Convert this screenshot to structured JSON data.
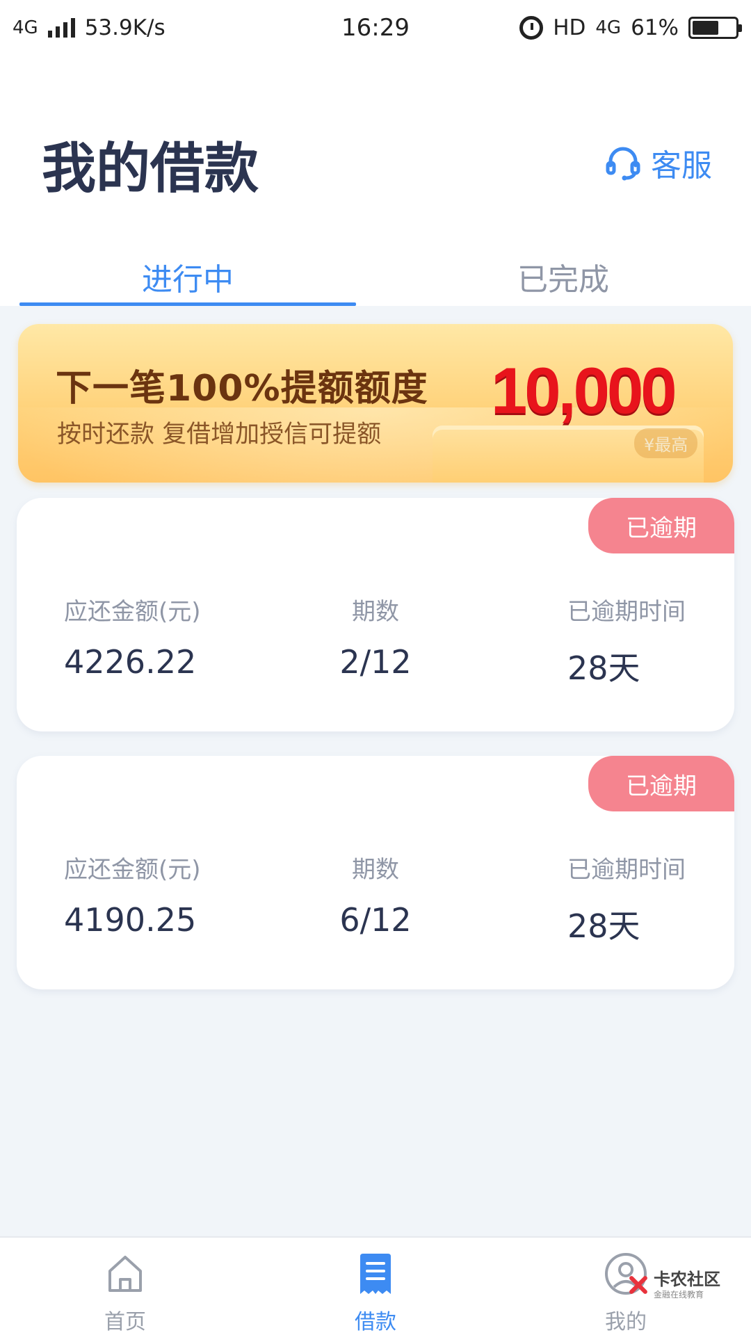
{
  "status_bar": {
    "network": "4G",
    "speed": "53.9K/s",
    "time": "16:29",
    "hd": "HD",
    "net_right": "4G",
    "battery": "61%",
    "battery_level": 0.61
  },
  "header": {
    "title": "我的借款",
    "service_label": "客服"
  },
  "tabs": [
    {
      "label": "进行中",
      "active": true
    },
    {
      "label": "已完成",
      "active": false
    }
  ],
  "banner": {
    "title": "下一笔100%提额额度",
    "subtitle": "按时还款  复借增加授信可提额",
    "amount": "10,000",
    "max_label": "¥最高"
  },
  "loans": [
    {
      "badge": "已逾期",
      "amount_label": "应还金额(元)",
      "amount": "4226.22",
      "period_label": "期数",
      "period": "2/12",
      "overdue_label": "已逾期时间",
      "overdue": "28天"
    },
    {
      "badge": "已逾期",
      "amount_label": "应还金额(元)",
      "amount": "4190.25",
      "period_label": "期数",
      "period": "6/12",
      "overdue_label": "已逾期时间",
      "overdue": "28天"
    }
  ],
  "bottom_nav": [
    {
      "label": "首页",
      "icon": "home-icon",
      "active": false
    },
    {
      "label": "借款",
      "icon": "document-icon",
      "active": true
    },
    {
      "label": "我的",
      "icon": "user-icon",
      "active": false
    }
  ],
  "watermark": {
    "title": "卡农社区",
    "subtitle": "金融在线教育"
  },
  "colors": {
    "accent": "#3d8bf2",
    "overdue": "#f5848f",
    "title": "#2b3450",
    "amount_red": "#e8141c"
  }
}
